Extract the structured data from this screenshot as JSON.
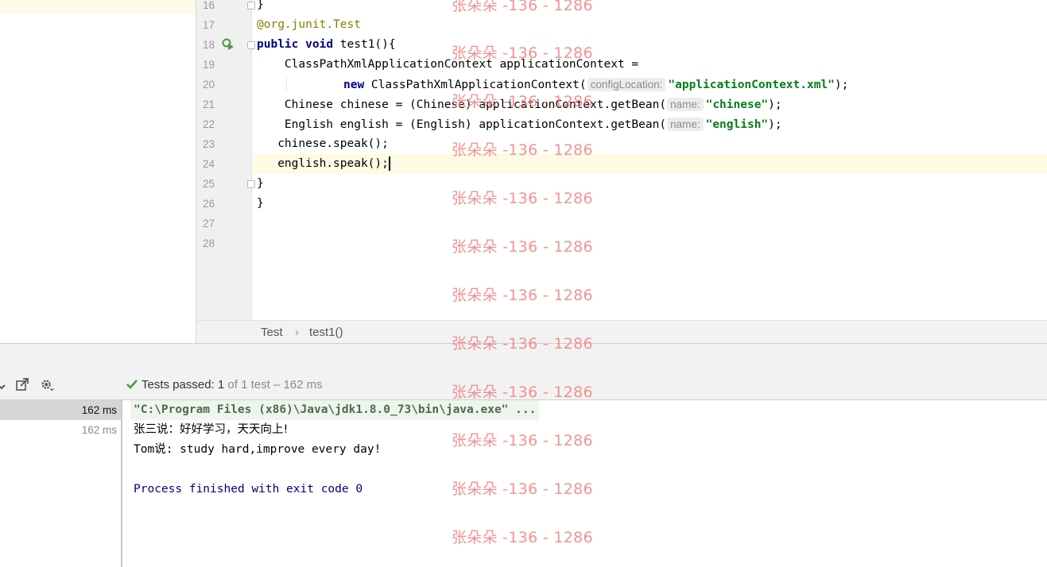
{
  "editor": {
    "line_numbers": [
      "16",
      "17",
      "18",
      "19",
      "20",
      "21",
      "22",
      "23",
      "24",
      "25",
      "26",
      "27",
      "28"
    ],
    "lines": {
      "l16": "}",
      "l17_annotation": "@org.junit.Test",
      "l18": {
        "kw1": "public",
        "kw2": "void",
        "rest": " test1(){"
      },
      "l19": "    ClassPathXmlApplicationContext applicationContext =",
      "l20": {
        "kw": "new",
        "pre": " ClassPathXmlApplicationContext(",
        "hint": "configLocation:",
        "str": "\"applicationContext.xml\"",
        "post": ");"
      },
      "l21": {
        "pre": "    Chinese chinese = (Chinese) applicationContext.getBean(",
        "hint": "name:",
        "str": "\"chinese\"",
        "post": ");"
      },
      "l22": {
        "pre": "    English english = (English) applicationContext.getBean(",
        "hint": "name:",
        "str": "\"english\"",
        "post": ");"
      },
      "l23": "   chinese.speak();",
      "l24": "   english.speak();",
      "l25": "}",
      "l26": "}"
    },
    "gutter_icon": "run-test-icon"
  },
  "breadcrumb": {
    "items": [
      "Test",
      "test1()"
    ],
    "separator": "›"
  },
  "run_panel": {
    "status": {
      "prefix": "Tests passed: ",
      "count": "1",
      "suffix": " of 1 test – 162 ms"
    },
    "toolbar_icons": [
      "chevron-icon",
      "export-icon",
      "settings-icon",
      "check-icon"
    ],
    "tree_rows": [
      {
        "label": "162 ms",
        "selected": true
      },
      {
        "label": "162 ms",
        "selected": false
      }
    ],
    "console": {
      "command": "\"C:\\Program Files (x86)\\Java\\jdk1.8.0_73\\bin\\java.exe\" ...",
      "out1": "张三说：好好学习，天天向上!",
      "out2": "Tom说: study hard,improve every day!",
      "exit": "Process finished with exit code 0"
    }
  },
  "watermark": {
    "text": "张朵朵 -136 - 1286",
    "color": "#ef7c7c"
  },
  "colors": {
    "keyword": "#000080",
    "annotation": "#808000",
    "string": "#067d17",
    "current_line": "#fffae3",
    "passed": "#4a9c3b"
  }
}
